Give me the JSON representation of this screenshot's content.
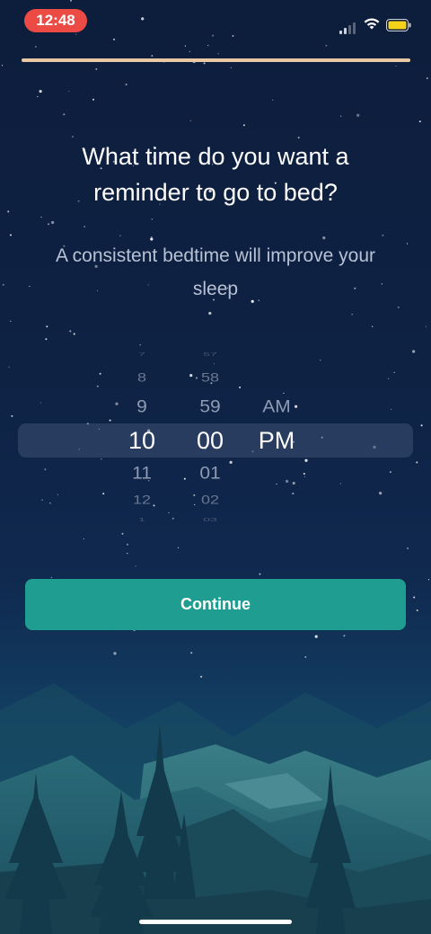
{
  "status_bar": {
    "time": "12:48",
    "cellular_icon": "cellular-signal-icon",
    "wifi_icon": "wifi-icon",
    "battery_icon": "battery-icon",
    "battery_color": "#f5d21a"
  },
  "onboarding": {
    "progress": 1.0,
    "progress_color": "#e9c8a4"
  },
  "prompt": {
    "title": "What time do you want a reminder to go to bed?",
    "subtitle": "A consistent bedtime will improve your sleep"
  },
  "time_picker": {
    "hour": {
      "items": [
        "7",
        "8",
        "9",
        "10",
        "11",
        "12",
        "1"
      ],
      "selected": "10"
    },
    "minute": {
      "items": [
        "57",
        "58",
        "59",
        "00",
        "01",
        "02",
        "03"
      ],
      "selected": "00"
    },
    "period": {
      "items": [
        "AM",
        "PM"
      ],
      "selected": "PM"
    }
  },
  "continue_button": {
    "label": "Continue",
    "color": "#1f9d91"
  },
  "colors": {
    "accent": "#1f9d91",
    "background_top": "#0d1d3c",
    "status_time_pill": "#ec4a45"
  }
}
